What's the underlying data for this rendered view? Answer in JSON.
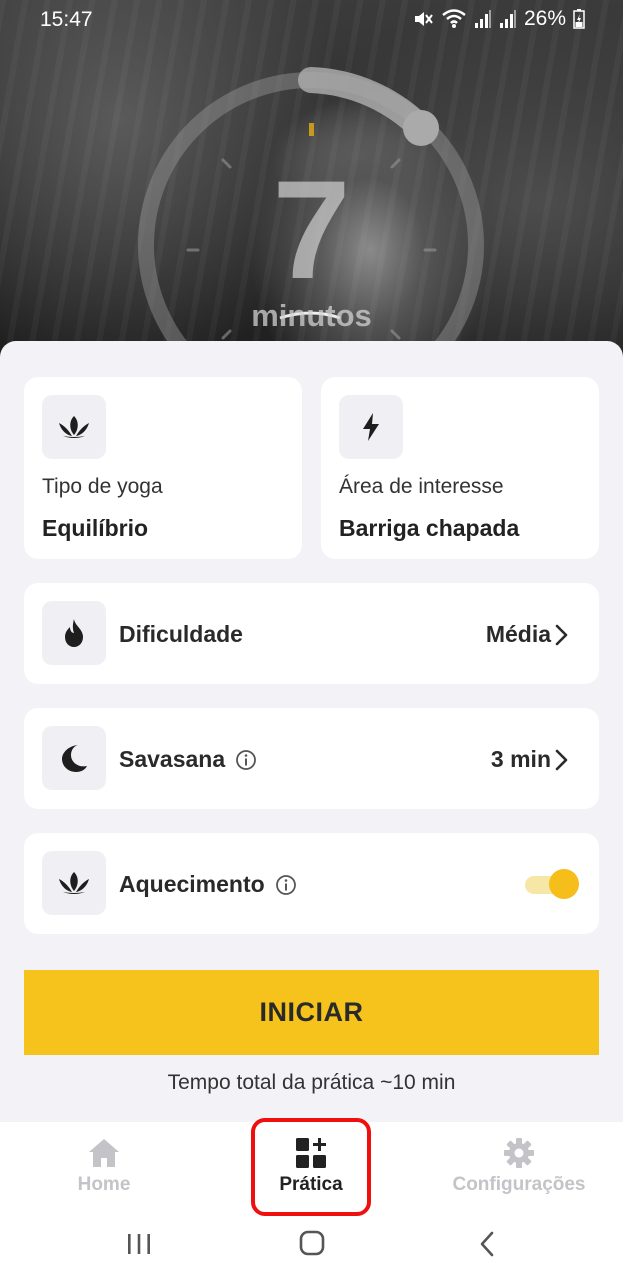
{
  "status_bar": {
    "time": "15:47",
    "battery": "26%",
    "icons": [
      "mute-icon",
      "wifi-icon",
      "signal-icon",
      "signal-icon",
      "battery-icon"
    ]
  },
  "timer": {
    "value": "7",
    "unit": "minutos"
  },
  "cards": {
    "yoga_type": {
      "icon": "lotus-icon",
      "label": "Tipo de yoga",
      "value": "Equilíbrio"
    },
    "focus_area": {
      "icon": "lightning-icon",
      "label": "Área de interesse",
      "value": "Barriga chapada"
    }
  },
  "settings": {
    "difficulty": {
      "icon": "flame-icon",
      "label": "Dificuldade",
      "value": "Média"
    },
    "savasana": {
      "icon": "moon-icon",
      "label": "Savasana",
      "value": "3 min",
      "info_icon": "info-icon"
    },
    "warmup": {
      "icon": "lotus-icon",
      "label": "Aquecimento",
      "info_icon": "info-icon",
      "enabled": true
    }
  },
  "start_button": {
    "label": "INICIAR"
  },
  "total_time": "Tempo total da prática ~10 min",
  "bottom_nav": {
    "items": [
      {
        "label": "Home",
        "icon": "home-icon",
        "active": false
      },
      {
        "label": "Prática",
        "icon": "grid-plus-icon",
        "active": true
      },
      {
        "label": "Configurações",
        "icon": "gear-icon",
        "active": false
      }
    ]
  },
  "colors": {
    "accent": "#f6c21c",
    "highlight": "#ef0f0f",
    "background": "#f2f2f7"
  }
}
